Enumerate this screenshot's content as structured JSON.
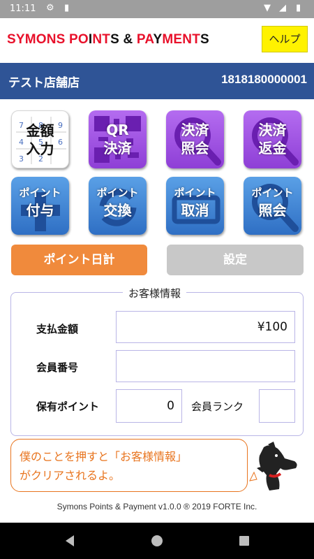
{
  "status": {
    "time": "11:11"
  },
  "header": {
    "brand_segments": [
      {
        "text": "SYMONS ",
        "red": true
      },
      {
        "text": "PO",
        "red": true
      },
      {
        "text": "I",
        "red": false
      },
      {
        "text": "NT",
        "red": true
      },
      {
        "text": "S",
        "red": false
      },
      {
        "text": " & ",
        "red": false
      },
      {
        "text": "PA",
        "red": true
      },
      {
        "text": "Y",
        "red": false
      },
      {
        "text": "MENT",
        "red": true
      },
      {
        "text": "S",
        "red": false
      }
    ],
    "help_label": "ヘルプ"
  },
  "store": {
    "name": "テスト店舗店",
    "id": "1818180000001"
  },
  "tiles": {
    "amount_input": {
      "line1": "金額",
      "line2": "入力"
    },
    "qr_payment": {
      "line1": "QR",
      "line2": "決済"
    },
    "payment_inquiry": {
      "line1": "決済",
      "line2": "照会"
    },
    "payment_refund": {
      "line1": "決済",
      "line2": "返金"
    },
    "point_grant": {
      "line1": "ポイント",
      "line2": "付与"
    },
    "point_exchange": {
      "line1": "ポイント",
      "line2": "交換"
    },
    "point_cancel": {
      "line1": "ポイント",
      "line2": "取消"
    },
    "point_inquiry": {
      "line1": "ポイント",
      "line2": "照会"
    }
  },
  "keypad_digits": [
    "7",
    "8",
    "9",
    "4",
    "5",
    "6",
    "3",
    "2"
  ],
  "buttons": {
    "daily_points": "ポイント日計",
    "settings": "設定"
  },
  "customer": {
    "title": "お客様情報",
    "payment_amount_label": "支払金額",
    "payment_amount_value": "¥100",
    "member_number_label": "会員番号",
    "member_number_value": "",
    "held_points_label": "保有ポイント",
    "held_points_value": "0",
    "member_rank_label": "会員ランク",
    "member_rank_value": ""
  },
  "bubble": {
    "line1": "僕のことを押すと「お客様情報」",
    "line2": "がクリアされるよ。"
  },
  "footer": {
    "text": "Symons Points & Payment v1.0.0 ® 2019 FORTE Inc."
  },
  "colors": {
    "brand_red": "#e8112b",
    "store_bar": "#2f5496",
    "tile_purple": "#9b4fe0",
    "tile_blue": "#3f82d6",
    "orange": "#f08a3c",
    "help_yellow": "#fff200"
  }
}
